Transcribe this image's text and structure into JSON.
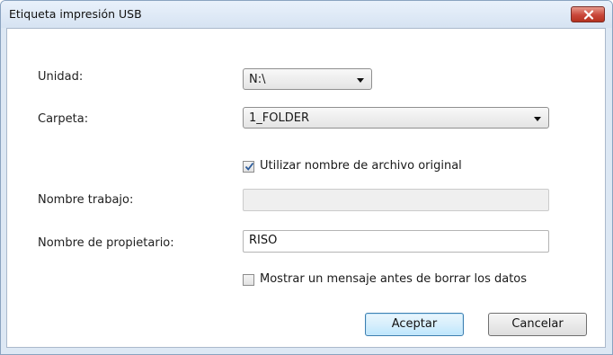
{
  "window": {
    "title": "Etiqueta impresión USB"
  },
  "form": {
    "unidad": {
      "label": "Unidad:",
      "value": "N:\\"
    },
    "carpeta": {
      "label": "Carpeta:",
      "value": "1_FOLDER"
    },
    "use_original_filename": {
      "label": "Utilizar nombre de archivo original",
      "checked": true
    },
    "nombre_trabajo": {
      "label": "Nombre trabajo:",
      "value": ""
    },
    "nombre_propietario": {
      "label": "Nombre de propietario:",
      "value": "RISO"
    },
    "mostrar_mensaje": {
      "label": "Mostrar un mensaje antes de borrar los datos",
      "checked": false
    }
  },
  "buttons": {
    "ok": "Aceptar",
    "cancel": "Cancelar"
  },
  "icons": {
    "close": "close-icon",
    "dropdown": "chevron-down-icon",
    "check": "check-icon"
  },
  "colors": {
    "close_button": "#c9473a",
    "default_button_border": "#3c7fb1",
    "titlebar": "#dde8f4"
  }
}
